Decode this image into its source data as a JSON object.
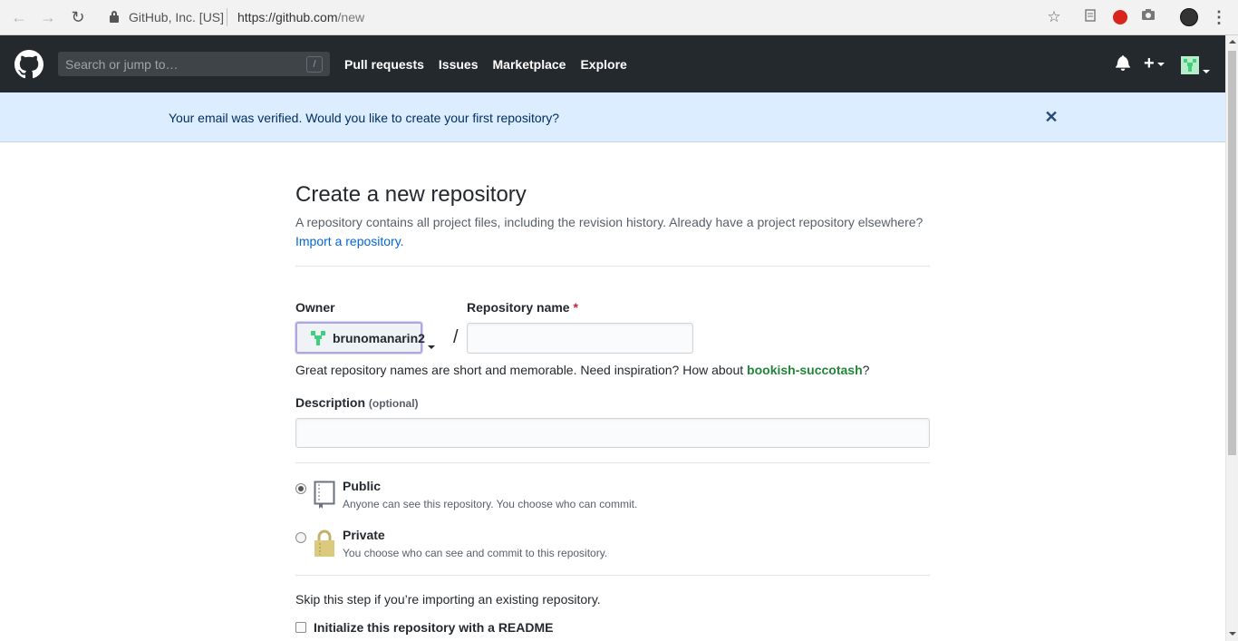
{
  "browser": {
    "site_identity": "GitHub, Inc. [US]",
    "url_host": "https://github.com",
    "url_path": "/new",
    "icons": [
      "back-icon",
      "forward-icon",
      "reload-icon",
      "lock-icon",
      "star-icon",
      "extension-icon",
      "camera-icon",
      "profile-icon",
      "menu-icon"
    ]
  },
  "header": {
    "search_placeholder": "Search or jump to…",
    "search_shortcut": "/",
    "nav": [
      "Pull requests",
      "Issues",
      "Marketplace",
      "Explore"
    ],
    "plus": "+",
    "colors": {
      "background": "#24292e",
      "text": "#ffffff"
    }
  },
  "flash": {
    "message": "Your email was verified. Would you like to create your first repository?",
    "close": "✕",
    "colors": {
      "background": "#dbedff"
    }
  },
  "main": {
    "title": "Create a new repository",
    "subtitle": "A repository contains all project files, including the revision history. Already have a project repository elsewhere?",
    "import_link": "Import a repository.",
    "owner_label": "Owner",
    "owner_value": "brunomanarin2",
    "separator": "/",
    "repo_name_label": "Repository name",
    "required_mark": "*",
    "repo_name_value": "",
    "hint_prefix": "Great repository names are short and memorable. Need inspiration? How about ",
    "hint_suggestion": "bookish-succotash",
    "hint_suffix": "?",
    "description_label": "Description",
    "description_optional": "(optional)",
    "description_value": "",
    "visibility": {
      "selected": "Public",
      "public_title": "Public",
      "public_desc": "Anyone can see this repository. You choose who can commit.",
      "private_title": "Private",
      "private_desc": "You choose who can see and commit to this repository."
    },
    "skip_text": "Skip this step if you’re importing an existing repository.",
    "readme_label": "Initialize this repository with a README",
    "readme_checked": false,
    "colors": {
      "link": "#0366d6",
      "suggestion": "#22863a",
      "required": "#cb2431"
    }
  }
}
